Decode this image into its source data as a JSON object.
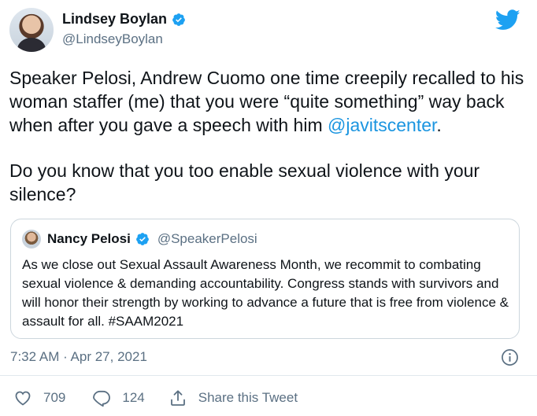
{
  "author": {
    "display_name": "Lindsey Boylan",
    "handle": "@LindseyBoylan"
  },
  "tweet": {
    "text_before_mention": "Speaker Pelosi, Andrew Cuomo one time creepily recalled to his woman staffer (me) that you were “quite something” way back when after you gave a speech with him ",
    "mention": "@javitscenter",
    "text_after_mention": ".",
    "paragraph2": "Do you know that you too enable sexual violence with your silence?"
  },
  "quote": {
    "display_name": "Nancy Pelosi",
    "handle": "@SpeakerPelosi",
    "text": "As we close out Sexual Assault Awareness Month, we recommit to combating sexual violence & demanding accountability. Congress stands with survivors and will honor their strength by working to advance a future that is free from violence & assault for all. #SAAM2021"
  },
  "meta": {
    "timestamp": "7:32 AM · Apr 27, 2021"
  },
  "actions": {
    "likes": "709",
    "replies": "124",
    "share_label": "Share this Tweet"
  },
  "colors": {
    "twitter_blue": "#1da1f2",
    "link_blue": "#1b95e0",
    "secondary_text": "#5b7083",
    "border": "#ccd6dd"
  },
  "icons": [
    "twitter-bird-icon",
    "verified-badge-icon",
    "info-icon",
    "heart-icon",
    "reply-icon",
    "share-icon"
  ]
}
